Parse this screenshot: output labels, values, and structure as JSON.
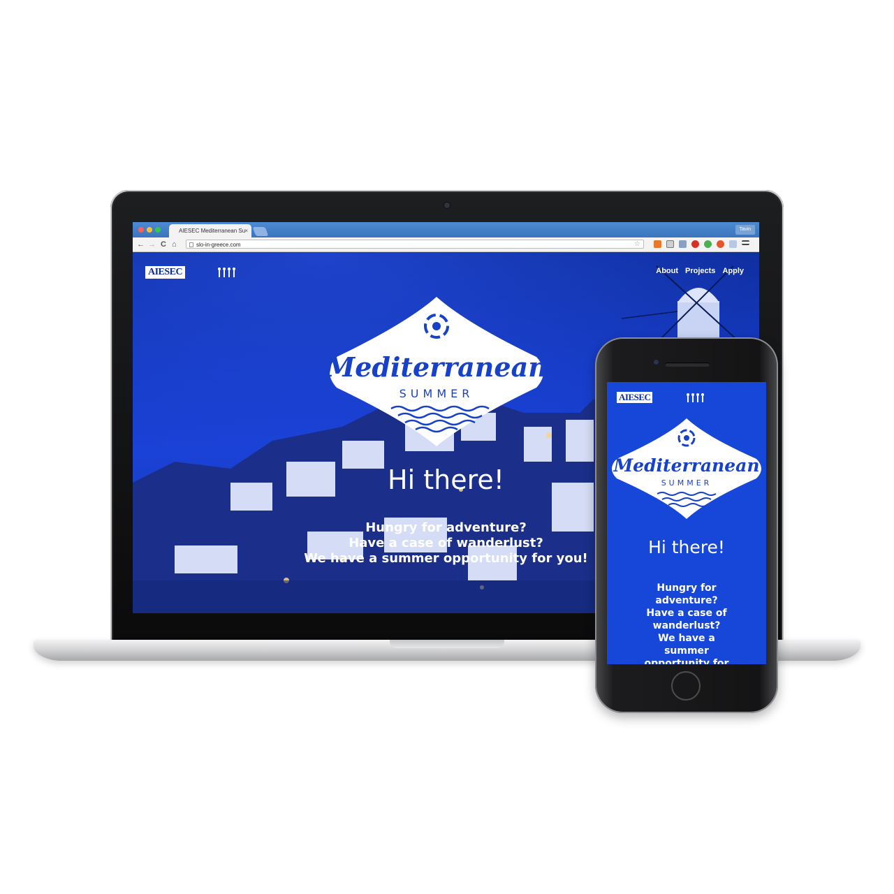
{
  "browser": {
    "tab_title": "AIESEC Mediterranean Su",
    "tab_close": "×",
    "user": "Tavin",
    "url": "slo-in-greece.com",
    "back": "←",
    "forward": "→",
    "reload": "C",
    "home": "⌂",
    "star": "☆"
  },
  "site": {
    "logo": "AIESEC",
    "nav": [
      "About",
      "Projects",
      "Apply"
    ],
    "badge_title": "Mediterranean",
    "badge_sub": "SUMMER",
    "greeting": "Hi there!",
    "lines": [
      "Hungry for adventure?",
      "Have a case of wanderlust?",
      "We have a summer opportunity for you!"
    ]
  },
  "phone": {
    "logo": "AIESEC",
    "badge_title": "Mediterranean",
    "badge_sub": "SUMMER",
    "greeting": "Hi there!",
    "lines": [
      "Hungry for",
      "adventure?",
      "Have a case of",
      "wanderlust?",
      "We have a",
      "summer",
      "opportunity for"
    ]
  },
  "colors": {
    "brand_blue": "#1741c8",
    "site_bg": "#1a42d6",
    "chrome_tab_bar": "#3a74bd"
  },
  "icons": [
    "swirl-icon",
    "waves-icon",
    "aiesec-figures-icon",
    "star-icon",
    "rss-icon",
    "extension-icon",
    "adblock-icon",
    "menu-icon"
  ]
}
